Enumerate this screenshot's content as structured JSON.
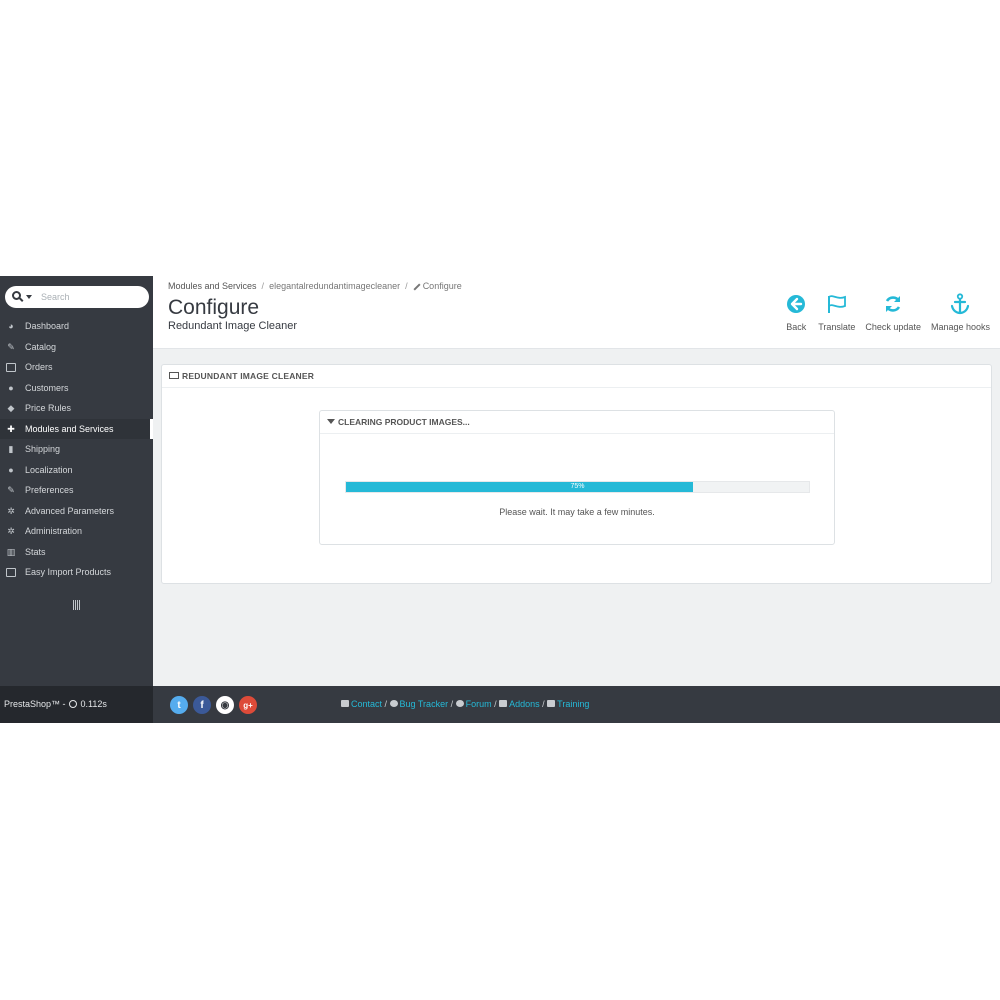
{
  "sidebar": {
    "search_placeholder": "Search",
    "items": [
      {
        "label": "Dashboard",
        "icon": "dashboard-icon"
      },
      {
        "label": "Catalog",
        "icon": "catalog-icon"
      },
      {
        "label": "Orders",
        "icon": "credit-card-icon"
      },
      {
        "label": "Customers",
        "icon": "users-icon"
      },
      {
        "label": "Price Rules",
        "icon": "tags-icon"
      },
      {
        "label": "Modules and Services",
        "icon": "puzzle-icon",
        "active": true
      },
      {
        "label": "Shipping",
        "icon": "truck-icon"
      },
      {
        "label": "Localization",
        "icon": "globe-icon"
      },
      {
        "label": "Preferences",
        "icon": "wrench-icon"
      },
      {
        "label": "Advanced Parameters",
        "icon": "cogs-icon"
      },
      {
        "label": "Administration",
        "icon": "cog-icon"
      },
      {
        "label": "Stats",
        "icon": "bar-chart-icon"
      },
      {
        "label": "Easy Import Products",
        "icon": "file-excel-icon"
      }
    ]
  },
  "header": {
    "breadcrumb": {
      "item1": "Modules and Services",
      "item2": "elegantalredundantimagecleaner",
      "item3": "Configure"
    },
    "title": "Configure",
    "subtitle": "Redundant Image Cleaner",
    "toolbar": {
      "back": "Back",
      "translate": "Translate",
      "check_update": "Check update",
      "manage_hooks": "Manage hooks"
    }
  },
  "panel": {
    "title": "REDUNDANT IMAGE CLEANER",
    "inner_title": "CLEARING PRODUCT IMAGES...",
    "progress": 75,
    "progress_label": "75%",
    "wait_text": "Please wait. It may take a few minutes."
  },
  "footer": {
    "brand": "PrestaShop™",
    "time": "0.112s",
    "social": [
      "twitter",
      "facebook",
      "github",
      "google-plus"
    ],
    "links": {
      "contact": "Contact",
      "bug_tracker": "Bug Tracker",
      "forum": "Forum",
      "addons": "Addons",
      "training": "Training"
    }
  },
  "colors": {
    "accent": "#25b9d7",
    "sidebar_bg": "#363a41",
    "twitter": "#55acee",
    "facebook": "#3b5998",
    "github": "#ffffff",
    "google_plus": "#dd4b39"
  }
}
